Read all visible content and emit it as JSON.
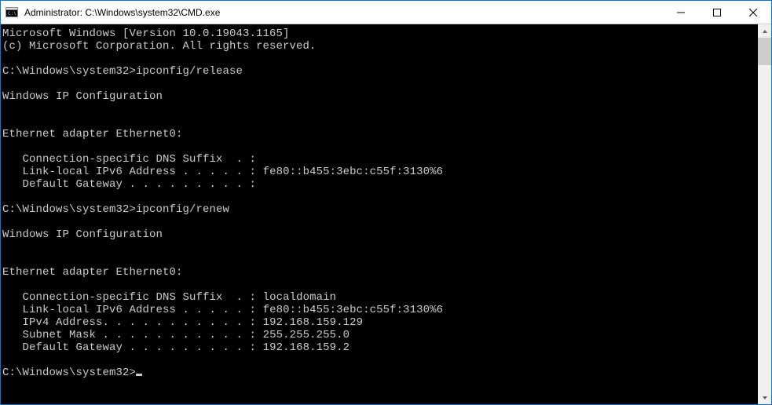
{
  "window": {
    "title": "Administrator: C:\\Windows\\system32\\CMD.exe"
  },
  "console": {
    "version_line": "Microsoft Windows [Version 10.0.19043.1165]",
    "copyright_line": "(c) Microsoft Corporation. All rights reserved.",
    "prompt1": "C:\\Windows\\system32>",
    "cmd1": "ipconfig/release",
    "ipconfig_header1": "Windows IP Configuration",
    "adapter_header1": "Ethernet adapter Ethernet0:",
    "release": {
      "dns_suffix_label": "   Connection-specific DNS Suffix  . :",
      "ipv6_label": "   Link-local IPv6 Address . . . . . : ",
      "ipv6_value": "fe80::b455:3ebc:c55f:3130%6",
      "gateway_label": "   Default Gateway . . . . . . . . . :"
    },
    "prompt2": "C:\\Windows\\system32>",
    "cmd2": "ipconfig/renew",
    "ipconfig_header2": "Windows IP Configuration",
    "adapter_header2": "Ethernet adapter Ethernet0:",
    "renew": {
      "dns_suffix_label": "   Connection-specific DNS Suffix  . : ",
      "dns_suffix_value": "localdomain",
      "ipv6_label": "   Link-local IPv6 Address . . . . . : ",
      "ipv6_value": "fe80::b455:3ebc:c55f:3130%6",
      "ipv4_label": "   IPv4 Address. . . . . . . . . . . : ",
      "ipv4_value": "192.168.159.129",
      "mask_label": "   Subnet Mask . . . . . . . . . . . : ",
      "mask_value": "255.255.255.0",
      "gateway_label": "   Default Gateway . . . . . . . . . : ",
      "gateway_value": "192.168.159.2"
    },
    "prompt3": "C:\\Windows\\system32>"
  }
}
